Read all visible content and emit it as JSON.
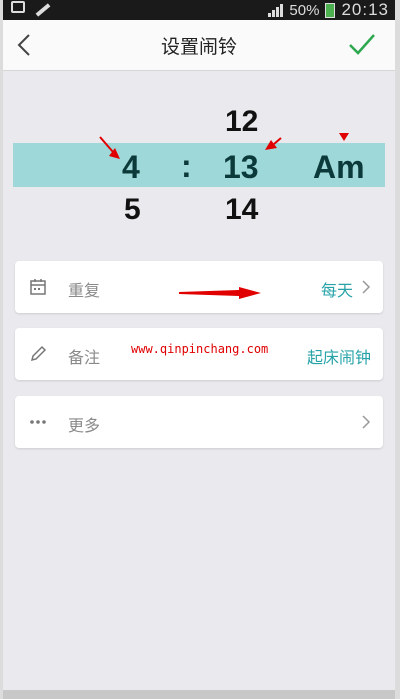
{
  "status_bar": {
    "battery": "50%",
    "time": "20:13"
  },
  "header": {
    "title": "设置闹铃"
  },
  "picker": {
    "above": {
      "hour": "12"
    },
    "selected": {
      "hour": "4",
      "separator": ":",
      "minute": "13",
      "ampm": "Am"
    },
    "below": {
      "hour": "5",
      "minute": "14"
    }
  },
  "rows": {
    "repeat": {
      "label": "重复",
      "value": "每天"
    },
    "note": {
      "label": "备注",
      "value": "起床闹钟"
    },
    "more": {
      "label": "更多"
    }
  },
  "watermark": "www.qinpinchang.com",
  "colors": {
    "accent": "#27a3a8",
    "highlight": "#9fd8d9",
    "confirm": "#2ea84f",
    "annotation": "#e00000"
  }
}
